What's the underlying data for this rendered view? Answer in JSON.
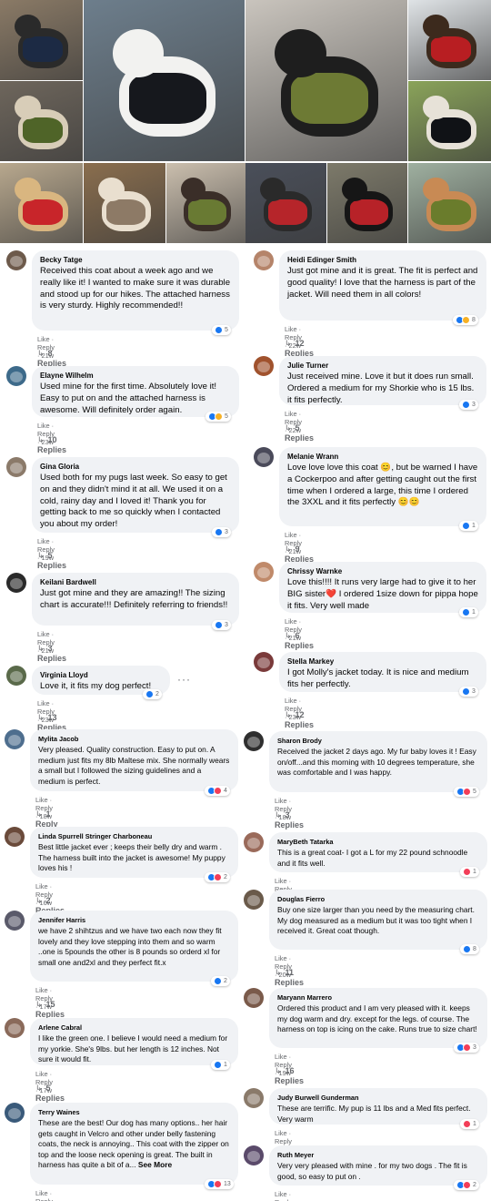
{
  "photos": [
    {
      "name": "photo-dog-black-coat-porch",
      "bg": "#8a7a66",
      "dog": "#2a2a2a",
      "coat": "#1c2a44"
    },
    {
      "name": "photo-white-dog-black-jacket",
      "bg": "#6d7e8c",
      "dog": "#f2f2f0",
      "coat": "#16181d"
    },
    {
      "name": "photo-black-dog-green-jacket",
      "bg": "#c9c4bd",
      "dog": "#1e1e1e",
      "coat": "#6d7a34"
    },
    {
      "name": "photo-small-dog-red-jacket-snow",
      "bg": "#dfe3e6",
      "dog": "#3c2a1d",
      "coat": "#b81e22"
    },
    {
      "name": "photo-dog-green-jacket-car",
      "bg": "#6e665c",
      "dog": "#d8cdb8",
      "coat": "#4f6428"
    },
    {
      "name": "photo-dog-black-jacket-grass",
      "bg": "#8aa35a",
      "dog": "#e7e2d8",
      "coat": "#101216"
    },
    {
      "name": "photo-chihuahua-red-jacket",
      "bg": "#b8a88e",
      "dog": "#d9b680",
      "coat": "#c8252a"
    },
    {
      "name": "photo-shihtzu-fluffy",
      "bg": "#8a6e4e",
      "dog": "#e9dfcf",
      "coat": "#8d7a66"
    },
    {
      "name": "photo-dog-red-harness-indoor",
      "bg": "#a69683",
      "dog": "#5a4a3a",
      "coat": "#b4242b"
    },
    {
      "name": "photo-dog-green-jacket-floor",
      "bg": "#cbbfae",
      "dog": "#3a2e28",
      "coat": "#697a33"
    },
    {
      "name": "photo-dogs-red-jacket-couch",
      "bg": "#4a4f5a",
      "dog": "#2a2a2a",
      "coat": "#b6252a"
    },
    {
      "name": "photo-black-dog-red-jacket-ground",
      "bg": "#7d7a6a",
      "dog": "#161616",
      "coat": "#b72228"
    },
    {
      "name": "photo-poodle-green-jacket",
      "bg": "#9fb0a0",
      "dog": "#c88a54",
      "coat": "#6a7c2c"
    }
  ],
  "comments": [
    {
      "name": "Becky Tatge",
      "text": "Received this coat about a week ago and we really like it! I wanted to make sure it was durable and stood up for our hikes. The attached harness is very sturdy. Highly recommended!!",
      "meta": "Like · Reply · 21w",
      "reactions": "5",
      "replies": "8 Replies"
    },
    {
      "name": "Elayne Wilhelm",
      "text": "Used mine for the first time. Absolutely love it! Easy to put on and the attached harness is awesome. Will definitely order again.",
      "meta": "Like · Reply · 23w",
      "reactions": "5",
      "replies": "10 Replies"
    },
    {
      "name": "Gina Gloria",
      "text": "Used both for my pugs last week. So easy to get on and they didn't mind it at all. We used it on a cold, rainy day and I loved it! Thank you for getting back to me so quickly when I contacted you about my order!",
      "meta": "Like · Reply · 19w",
      "reactions": "3",
      "replies": "5 Replies"
    },
    {
      "name": "Keilani Bardwell",
      "text": "Just got mine and they are amazing!! The sizing chart is accurate!!! Definitely referring to friends!!",
      "meta": "Like · Reply · 21w",
      "reactions": "3",
      "replies": "3 Replies"
    },
    {
      "name": "Virginia Lloyd",
      "text": "Love it, it fits my dog perfect!",
      "meta": "Like · Reply · 23w",
      "reactions": "2",
      "replies": "13 Replies"
    },
    {
      "name": "Heidi Edinger Smith",
      "text": "Just got mine and it is great. The fit is perfect and good quality! I love that the harness is part of the jacket. Will need them in all colors!",
      "meta": "Like · Reply · 22w",
      "reactions": "8",
      "replies": "12 Replies"
    },
    {
      "name": "Julie Turner",
      "text": "Just received mine. Love it but it does run small. Ordered a medium for my Shorkie who is 15 lbs. it fits perfectly.",
      "meta": "Like · Reply · 22w",
      "reactions": "3",
      "replies": "5 Replies"
    },
    {
      "name": "Melanie Wrann",
      "text": "Love love love this coat 😊, but be warned I have a Cockerpoo and after getting caught out the first time when I ordered a large, this time I ordered the 3XXL and it fits perfectly 😊😊",
      "meta": "Like · Reply · 21w",
      "reactions": "1",
      "replies": "9 Replies"
    },
    {
      "name": "Chrissy Warnke",
      "text": "Love this!!!! It runs very large had to give it to her BIG sister❤️ I ordered 1size down for pippa hope it fits. Very well made",
      "meta": "Like · Reply · 21w",
      "reactions": "1",
      "replies": "6 Replies"
    },
    {
      "name": "Stella Markey",
      "text": "I got Molly's jacket today. It is nice and medium fits her perfectly.",
      "meta": "Like · Reply · 23w",
      "reactions": "3",
      "replies": "12 Replies"
    },
    {
      "name": "Mylita Jacob",
      "text": "Very pleased. Quality construction. Easy to put on. A medium just fits my 8lb Maltese mix. She normally wears a small but I followed the sizing guidelines and a medium is perfect.",
      "meta": "Like · Reply · 18w",
      "reactions": "4",
      "replies": "1 Reply"
    },
    {
      "name": "Linda Spurrell Stringer Charboneau",
      "text": "Best little jacket ever ; keeps their belly dry and warm . The harness built into the jacket is awesome! My puppy loves his !",
      "meta": "Like · Reply · 16w",
      "reactions": "2",
      "replies": "2 Replies"
    },
    {
      "name": "Jennifer Harris",
      "text": "we have 2 shihtzus and we have two each now they fit lovely and they love stepping into them and so warm ..one is 5pounds the other is 8 pounds so orderd xl for small one and2xl and they perfect fit.x",
      "meta": "Like · Reply · 17w",
      "reactions": "2",
      "replies": "15 Replies"
    },
    {
      "name": "Arlene Cabral",
      "text": "I like the green one. I believe I would need a medium for my yorkie. She's 9lbs. but her length is 12 inches. Not sure it would fit.",
      "meta": "Like · Reply · 17w",
      "reactions": "1",
      "replies": "5 Replies"
    },
    {
      "name": "Terry Waines",
      "text": "These are the best! Our dog has many options.. her hair gets caught in Velcro and other under belly fastening coats, the neck is annoying.. This coat with the zipper on top and the loose neck opening is great. The built in harness has quite a bit of a...",
      "see_more": "See More",
      "meta": "Like · Reply · 22w",
      "reactions": "13",
      "replies": ""
    },
    {
      "name": "Sharon Brody",
      "text": "Received the jacket 2 days ago. My fur baby loves it ! Easy on/off...and this morning with 10 degrees temperature, she was comfortable and I was happy.",
      "meta": "Like · Reply · 18w",
      "reactions": "5",
      "replies": "3 Replies"
    },
    {
      "name": "MaryBeth Tatarka",
      "text": "This is a great coat- I got a L for my 22 pound schnoodle and it fits well.",
      "meta": "Like · Reply · 9w",
      "reactions": "1",
      "replies": ""
    },
    {
      "name": "Douglas Fierro",
      "text": "Buy one size larger than you need by the measuring chart. My dog measured as a medium but it was too tight when I received it. Great coat though.",
      "meta": "Like · Reply · 20w",
      "reactions": "8",
      "replies": "11 Replies"
    },
    {
      "name": "Maryann Marrero",
      "text": "Ordered this product and I am very pleased with it. keeps my dog warm and dry. except for the legs. of course. The harness on top is icing on the cake. Runs true to size chart!",
      "meta": "Like · Reply · 19w",
      "reactions": "3",
      "replies": "16 Replies"
    },
    {
      "name": "Judy Burwell Gunderman",
      "text": "These are terrific. My pup is 11 lbs and a Med fits perfect. Very warm",
      "meta": "Like · Reply · 9w",
      "reactions": "1",
      "replies": ""
    },
    {
      "name": "Ruth Meyer",
      "text": "Very very pleased with mine . for my two dogs . The fit is good, so easy to put on .",
      "meta": "Like · Reply · 19w",
      "reactions": "2",
      "replies": ""
    }
  ],
  "colors": {
    "like_blue": "#1877f2",
    "love_red": "#f33e58",
    "haha_yellow": "#f7b125",
    "bubble": "#f0f2f5",
    "meta_gray": "#65676b"
  },
  "icons": {
    "reply_arrow": "↳",
    "more": "···"
  }
}
